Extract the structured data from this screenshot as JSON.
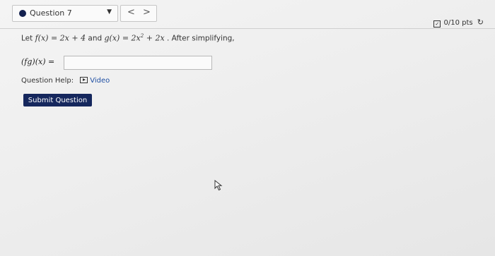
{
  "question_selector": {
    "label": "Question 7",
    "caret": "▼"
  },
  "navigation": {
    "prev_symbol": "<",
    "next_symbol": ">"
  },
  "score": {
    "text": "0/10 pts",
    "check_icon": "✓",
    "retry_icon": "↻"
  },
  "problem": {
    "lead": "Let ",
    "f_def": "f(x) = 2x + 4",
    "and_text": " and ",
    "g_def": "g(x) = 2x",
    "g_exp": "2",
    "g_tail": " + 2x",
    "after_text": ". After simplifying,"
  },
  "answer": {
    "label": "(fg)(x) =",
    "value": "",
    "placeholder": ""
  },
  "help": {
    "label": "Question Help:",
    "video_label": "Video"
  },
  "submit": {
    "label": "Submit Question"
  },
  "icons": {
    "question_dot": "filled-circle",
    "video": "video-play-icon",
    "cursor": "mouse-pointer-icon"
  },
  "colors": {
    "primary_navy": "#15275d",
    "link_blue": "#1f4fa3"
  }
}
